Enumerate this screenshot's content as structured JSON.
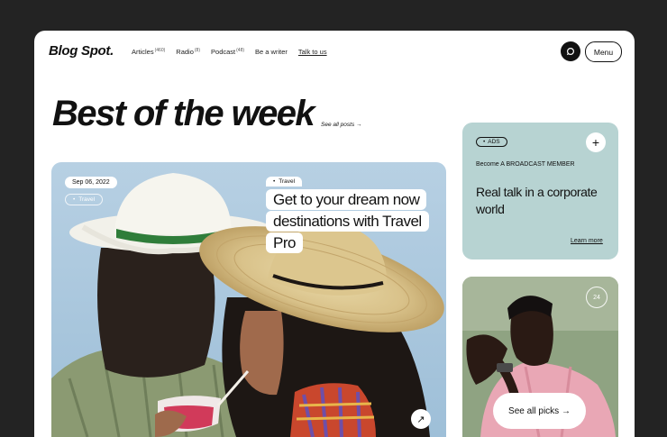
{
  "header": {
    "logo": "Blog Spot.",
    "nav": [
      {
        "label": "Articles",
        "count": "(460)"
      },
      {
        "label": "Radio",
        "count": "(8)"
      },
      {
        "label": "Podcast",
        "count": "(48)"
      },
      {
        "label": "Be a writer",
        "count": ""
      },
      {
        "label": "Talk to us",
        "count": ""
      }
    ],
    "search_icon": "search-icon",
    "menu_label": "Menu"
  },
  "hero": {
    "title": "Best of the week",
    "see_all_posts": "See all posts →"
  },
  "featured": {
    "date": "Sep 06, 2022",
    "tag": "Travel",
    "title_tag": "Travel",
    "title": "Get to your dream now destinations with Travel Pro",
    "arrow_icon": "arrow-up-right-icon",
    "arrow_glyph": "↗"
  },
  "ad": {
    "badge": "ADS",
    "plus_glyph": "+",
    "become": "Become A BROADCAST MEMBER",
    "headline": "Real talk in a corporate world",
    "cta": "Learn more",
    "bg_color": "#b7d3d2"
  },
  "picks": {
    "count": "24",
    "cta": "See all picks →"
  }
}
